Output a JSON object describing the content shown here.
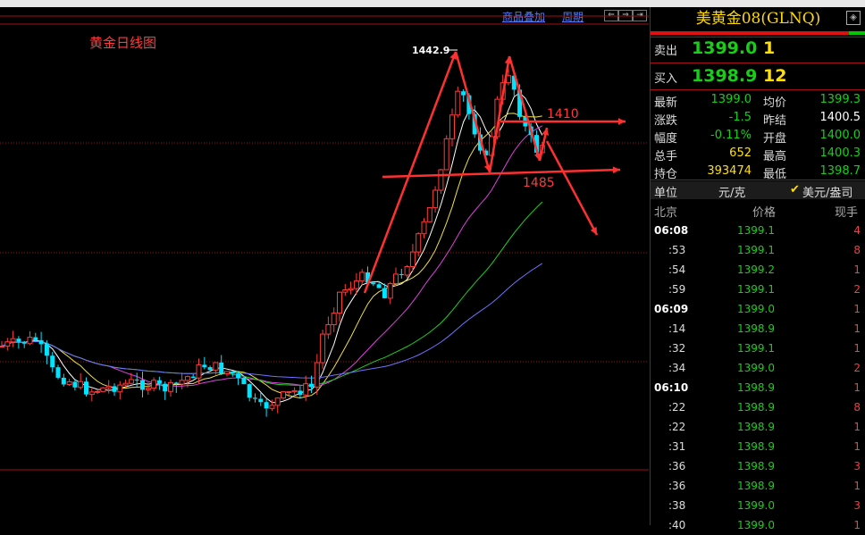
{
  "toolbar": {
    "overlay": "商品叠加",
    "period": "周期"
  },
  "chart_data": {
    "type": "candlestick",
    "title": "黄金日线图",
    "annotations": {
      "peak_label": "1442.9",
      "upper_level": "1410",
      "lower_level": "1485"
    },
    "colors": {
      "up": "#ff3b3b",
      "down": "#00e5ff",
      "ma1": "#ffffff",
      "ma2": "#f0e040",
      "ma3": "#e040e0",
      "ma4": "#20d020",
      "ma5": "#7070ff",
      "arrow": "#ff3030"
    }
  },
  "panel": {
    "symbol": "美黄金08(GLNQ)",
    "sell": {
      "label": "卖出",
      "price": "1399.0",
      "qty": "1"
    },
    "buy": {
      "label": "买入",
      "price": "1398.9",
      "qty": "12"
    },
    "stats": [
      {
        "l1": "最新",
        "v1": "1399.0",
        "l2": "均价",
        "v2": "1399.3"
      },
      {
        "l1": "涨跌",
        "v1": "-1.5",
        "l2": "昨结",
        "v2": "1400.5"
      },
      {
        "l1": "幅度",
        "v1": "-0.11%",
        "l2": "开盘",
        "v2": "1400.0"
      },
      {
        "l1": "总手",
        "v1": "652",
        "l2": "最高",
        "v2": "1400.3"
      },
      {
        "l1": "持仓",
        "v1": "393474",
        "l2": "最低",
        "v2": "1398.7"
      }
    ],
    "unit": {
      "label": "单位",
      "val": "元/克",
      "check": "✔",
      "alt": "美元/盎司"
    },
    "header": {
      "c1": "北京",
      "c2": "价格",
      "c3": "现手"
    },
    "ticks": [
      {
        "t": "06:08",
        "p": "1399.1",
        "q": "4"
      },
      {
        "t": ":53",
        "p": "1399.1",
        "q": "8"
      },
      {
        "t": ":54",
        "p": "1399.2",
        "q": "1"
      },
      {
        "t": ":59",
        "p": "1399.1",
        "q": "2"
      },
      {
        "t": "06:09",
        "p": "1399.0",
        "q": "1"
      },
      {
        "t": ":14",
        "p": "1398.9",
        "q": "1"
      },
      {
        "t": ":32",
        "p": "1399.1",
        "q": "1"
      },
      {
        "t": ":34",
        "p": "1399.0",
        "q": "2"
      },
      {
        "t": "06:10",
        "p": "1398.9",
        "q": "1"
      },
      {
        "t": ":22",
        "p": "1398.9",
        "q": "8"
      },
      {
        "t": ":22",
        "p": "1398.9",
        "q": "1"
      },
      {
        "t": ":31",
        "p": "1398.9",
        "q": "1"
      },
      {
        "t": ":36",
        "p": "1398.9",
        "q": "3"
      },
      {
        "t": ":36",
        "p": "1398.9",
        "q": "1"
      },
      {
        "t": ":38",
        "p": "1399.0",
        "q": "3"
      },
      {
        "t": ":40",
        "p": "1399.0",
        "q": "1"
      }
    ]
  }
}
